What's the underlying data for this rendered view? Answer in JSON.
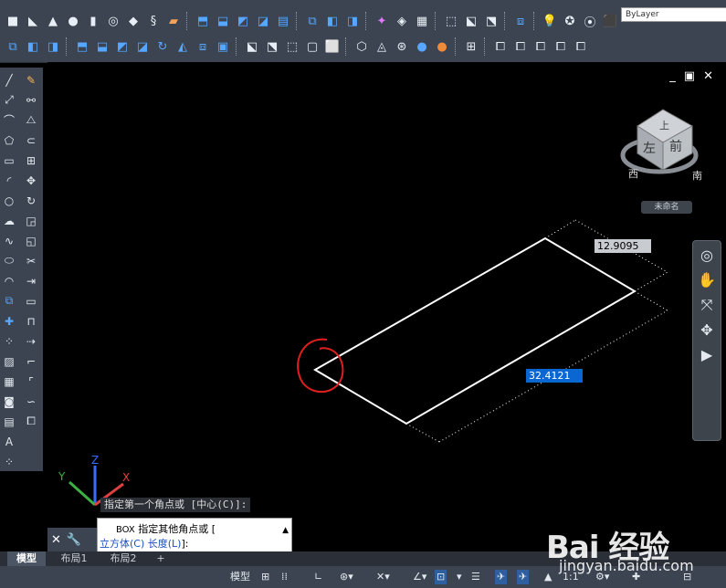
{
  "ribbon": {
    "layer_combo": "ByLayer",
    "row1_icons": [
      "box-icon",
      "wedge-icon",
      "cone-icon",
      "sphere-icon",
      "cylinder-icon",
      "torus-icon",
      "pyramid-icon",
      "helix-icon",
      "planar-surface-icon",
      "extrude-icon",
      "presspull-icon",
      "sweep-icon",
      "revolve-icon",
      "loft-icon",
      "union-icon",
      "subtract-icon",
      "intersect-icon",
      "interfere-icon",
      "slice-icon",
      "thicken-icon",
      "extract-edges-icon",
      "imprint-icon",
      "color-edges-icon",
      "copy-edges-icon",
      "light-icon",
      "materials-icon",
      "render-icon"
    ],
    "row2_icons": [
      "region-icon",
      "union2-icon",
      "subtract2-icon",
      "extrude-faces-icon",
      "move-faces-icon",
      "offset-faces-icon",
      "delete-faces-icon",
      "rotate-faces-icon",
      "taper-faces-icon",
      "copy-faces-icon",
      "color-faces-icon",
      "imprint2-icon",
      "clean-icon",
      "separate-icon",
      "shell-icon",
      "check-icon",
      "visual-style-2d-icon",
      "visual-style-hidden-icon",
      "visual-style-realistic-icon",
      "visual-style-conceptual-icon",
      "manage-styles-icon",
      "view-top-icon",
      "view-front-icon",
      "view-left-icon",
      "view-iso-icon",
      "view-iso2-icon"
    ]
  },
  "left_toolbar": {
    "col1": [
      "line-icon",
      "xline-icon",
      "polyline-icon",
      "polygon-icon",
      "rectangle-icon",
      "arc-icon",
      "circle-icon",
      "revcloud-icon",
      "spline-icon",
      "ellipse-icon",
      "ellipse-arc-icon",
      "insert-block-icon",
      "make-block-icon",
      "point-icon",
      "hatch-icon",
      "gradient-icon",
      "region-icon",
      "table-icon",
      "text-icon",
      "add-selected-icon"
    ],
    "col2": [
      "erase-icon",
      "copy-icon",
      "mirror-icon",
      "offset-icon",
      "array-icon",
      "move-icon",
      "rotate-icon",
      "scale-icon",
      "stretch-icon",
      "trim-icon",
      "extend-icon",
      "break-point-icon",
      "break-icon",
      "join-icon",
      "chamfer-icon",
      "fillet-icon",
      "blend-icon",
      "explode-icon"
    ]
  },
  "canvas": {
    "window_controls": [
      "_",
      "▣",
      "✕"
    ],
    "viewcube": {
      "top": "上",
      "left": "左",
      "front": "前",
      "compass_w": "西",
      "compass_s": "南",
      "ucs_name": "未命名"
    },
    "dimension_1": "12.9095",
    "dimension_2": "32.4121",
    "ucs": {
      "x": "X",
      "y": "Y",
      "z": "Z"
    }
  },
  "colors": {
    "accent": "#0a66d1",
    "annotation": "#e01f1f",
    "ucs_x": "#e04040",
    "ucs_y": "#3cb043",
    "ucs_z": "#3a6bff"
  },
  "command": {
    "history": "指定第一个角点或 [中心(C)]:",
    "prompt_cmd": "BOX",
    "prompt_text": "指定其他角点或 [",
    "option_cube": "立方体(C)",
    "option_length": "长度(L)",
    "prompt_end": "]:"
  },
  "layout_tabs": [
    "模型",
    "布局1",
    "布局2",
    "+"
  ],
  "statusbar": {
    "model": "模型",
    "scale": "1:1",
    "items": [
      "grid-icon",
      "snap-icon",
      "ortho-icon",
      "polar-icon",
      "osnap-icon",
      "otrack-icon",
      "ducs-icon",
      "dyn-icon",
      "lineweight-icon",
      "annotation-visibility-icon",
      "auto-scale-icon",
      "workspace-icon",
      "plus-icon",
      "isolate-icon"
    ]
  },
  "watermark": {
    "main": "Bai 经验",
    "sub": "jingyan.baidu.com"
  }
}
